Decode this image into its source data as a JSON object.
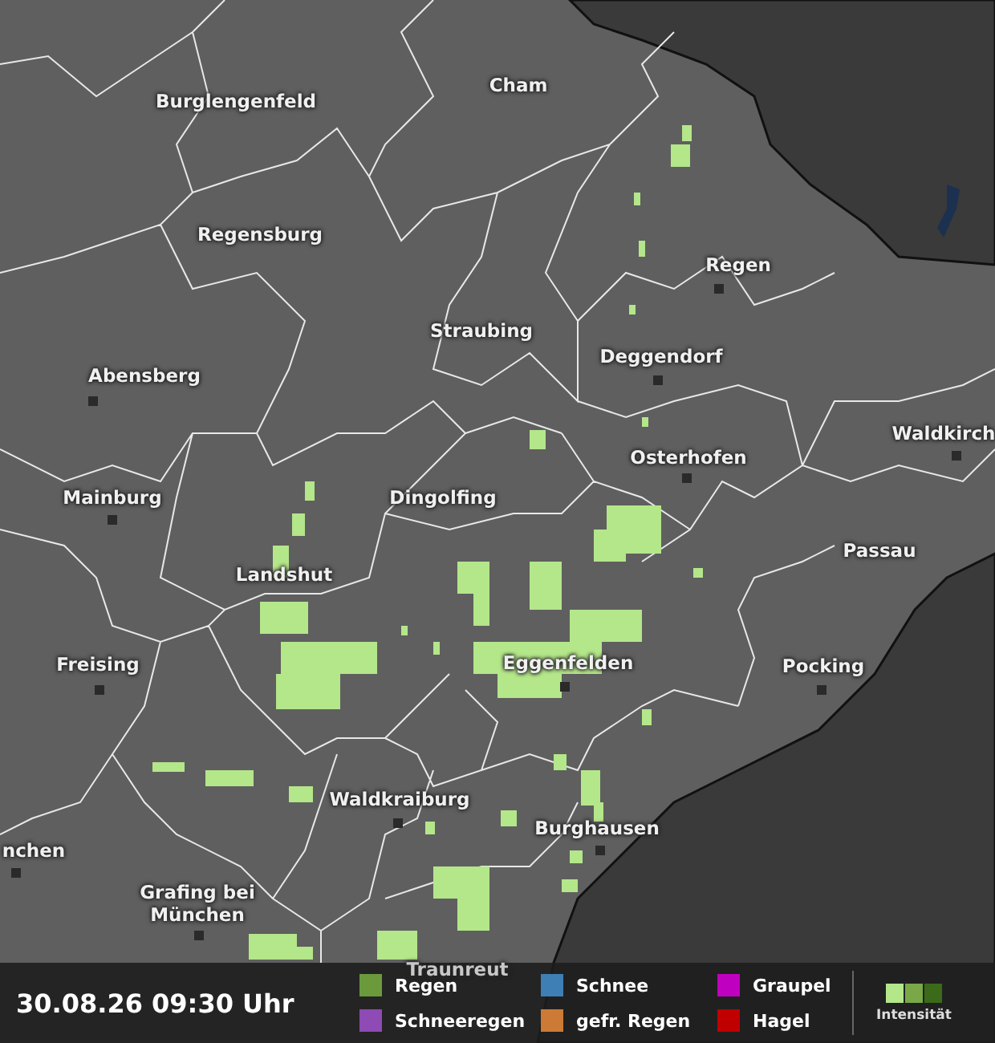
{
  "map": {
    "cities": [
      {
        "name": "Burglengenfeld"
      },
      {
        "name": "Cham"
      },
      {
        "name": "Regensburg"
      },
      {
        "name": "Regen"
      },
      {
        "name": "Straubing"
      },
      {
        "name": "Deggendorf"
      },
      {
        "name": "Abensberg"
      },
      {
        "name": "Waldkirch"
      },
      {
        "name": "Osterhofen"
      },
      {
        "name": "Mainburg"
      },
      {
        "name": "Dingolfing"
      },
      {
        "name": "Passau"
      },
      {
        "name": "Landshut"
      },
      {
        "name": "Freising"
      },
      {
        "name": "Eggenfelden"
      },
      {
        "name": "Pocking"
      },
      {
        "name": "Waldkraiburg"
      },
      {
        "name": "Burghausen"
      },
      {
        "name": "nchen"
      },
      {
        "name": "Grafing bei München"
      },
      {
        "name": "Traunreut"
      }
    ]
  },
  "footer": {
    "timestamp": "30.08.26 09:30 Uhr",
    "legend": [
      {
        "label": "Regen",
        "color": "#6a9a3c"
      },
      {
        "label": "Schneeregen",
        "color": "#8e4ab5"
      },
      {
        "label": "Schnee",
        "color": "#3e7fb5"
      },
      {
        "label": "gefr. Regen",
        "color": "#cc7a35"
      },
      {
        "label": "Graupel",
        "color": "#c000c0"
      },
      {
        "label": "Hagel",
        "color": "#c00000"
      }
    ],
    "intensity": {
      "label": "Intensität",
      "swatches": [
        {
          "color": "#b4e68a"
        },
        {
          "color": "#7aa848"
        },
        {
          "color": "#3b6a18"
        }
      ]
    }
  }
}
